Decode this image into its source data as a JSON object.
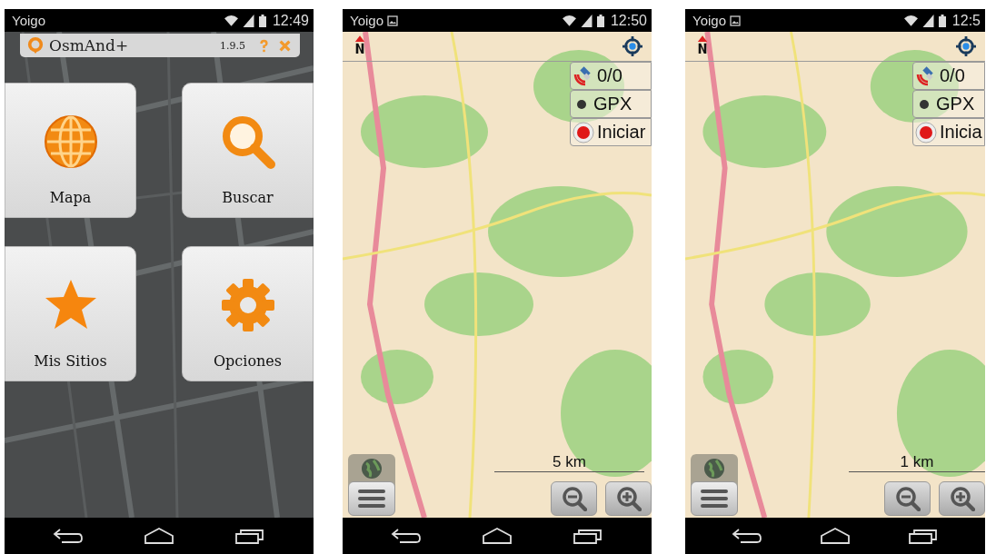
{
  "screens": [
    {
      "kind": "menu",
      "status_bar": {
        "carrier": "Yoigo",
        "notification": false,
        "time": "12:49"
      },
      "header": {
        "title": "OsmAnd+",
        "version": "1.9.5"
      },
      "tiles": [
        {
          "label": "Mapa"
        },
        {
          "label": "Buscar"
        },
        {
          "label": "Mis Sitios"
        },
        {
          "label": "Opciones"
        }
      ]
    },
    {
      "kind": "map",
      "status_bar": {
        "carrier": "Yoigo",
        "notification": true,
        "time": "12:50"
      },
      "widgets": [
        {
          "kind": "gps",
          "label": "0/0"
        },
        {
          "kind": "gpx",
          "label": "GPX"
        },
        {
          "kind": "record",
          "label": "Iniciar"
        }
      ],
      "scale": "5 km",
      "layer_button": true
    },
    {
      "kind": "map",
      "status_bar": {
        "carrier": "Yoigo",
        "notification": true,
        "time": "12:5"
      },
      "widgets": [
        {
          "kind": "gps",
          "label": "0/0"
        },
        {
          "kind": "gpx",
          "label": "GPX"
        },
        {
          "kind": "record",
          "label": "Inicia"
        }
      ],
      "scale": "1 km",
      "layer_button": true
    }
  ]
}
